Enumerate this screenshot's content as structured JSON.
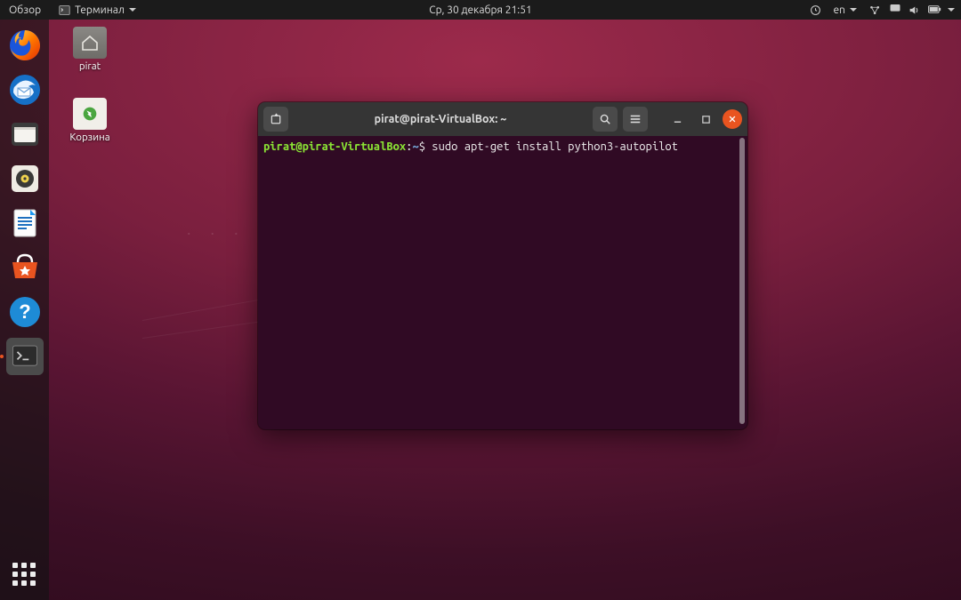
{
  "topbar": {
    "overview": "Обзор",
    "app_menu": "Терминал",
    "datetime": "Ср, 30 декабря  21:51",
    "lang": "en"
  },
  "desktop": {
    "home_label": "pirat",
    "trash_label": "Корзина"
  },
  "dock": {
    "items": [
      {
        "name": "firefox"
      },
      {
        "name": "thunderbird"
      },
      {
        "name": "files"
      },
      {
        "name": "rhythmbox"
      },
      {
        "name": "libreoffice-writer"
      },
      {
        "name": "ubuntu-software"
      },
      {
        "name": "help"
      },
      {
        "name": "terminal",
        "active": true
      }
    ]
  },
  "terminal": {
    "title": "pirat@pirat-VirtualBox: ~",
    "prompt_user": "pirat@pirat-VirtualBox",
    "prompt_sep": ":",
    "prompt_path": "~",
    "prompt_sym": "$",
    "command": "sudo apt-get install python3-autopilot"
  }
}
